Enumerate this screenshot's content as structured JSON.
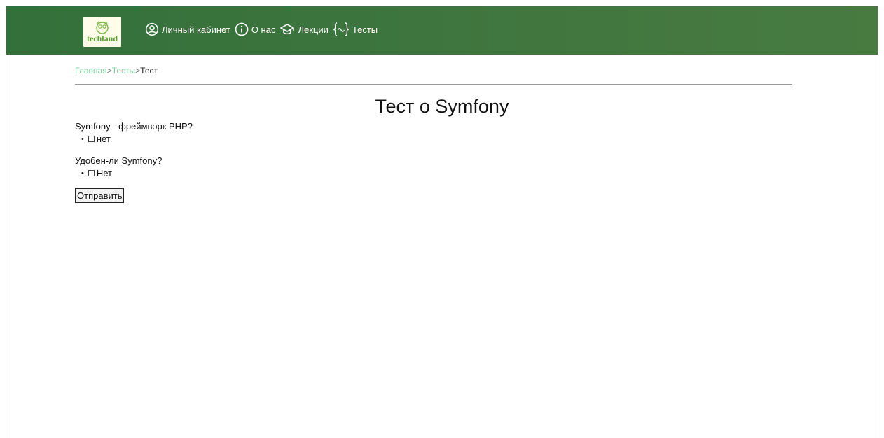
{
  "header": {
    "logo_text": "techland",
    "nav": [
      {
        "label": "Личный кабинет",
        "icon": "user-circle-icon"
      },
      {
        "label": "О нас",
        "icon": "info-icon"
      },
      {
        "label": "Лекции",
        "icon": "graduation-cap-icon"
      },
      {
        "label": "Тесты",
        "icon": "curly-braces-icon"
      }
    ]
  },
  "breadcrumb": {
    "home": "Главная",
    "tests": "Тесты",
    "current": "Тест",
    "separator": ">"
  },
  "page": {
    "title": "Тест о Symfony"
  },
  "questions": [
    {
      "text": "Symfony - фреймворк PHP?",
      "options": [
        "нет"
      ]
    },
    {
      "text": "Удобен-ли Symfony?",
      "options": [
        "Нет"
      ]
    }
  ],
  "form": {
    "submit_label": "Отправить"
  },
  "colors": {
    "header_bg": "#3b743c",
    "breadcrumb_link": "#7fcfa0",
    "logo_text": "#5aa632"
  }
}
